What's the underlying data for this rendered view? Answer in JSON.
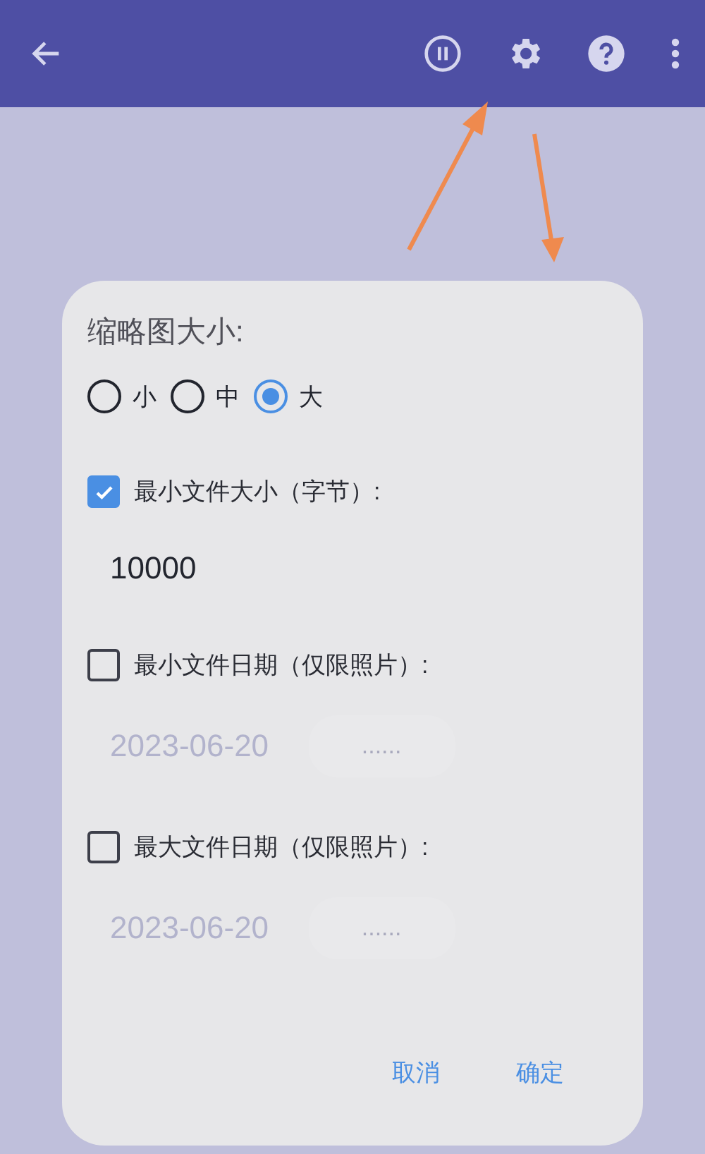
{
  "app_bar": {
    "buttons": [
      {
        "kind": "back"
      },
      {
        "kind": "pause"
      },
      {
        "kind": "settings"
      },
      {
        "kind": "help"
      },
      {
        "kind": "more"
      }
    ]
  },
  "dialog": {
    "title": "缩略图大小:",
    "size_options": [
      {
        "label": "小",
        "selected": false
      },
      {
        "label": "中",
        "selected": false
      },
      {
        "label": "大",
        "selected": true
      }
    ],
    "filters": [
      {
        "kind": "number",
        "label": "最小文件大小（字节）:",
        "checked": true,
        "value": "10000"
      },
      {
        "kind": "date",
        "label": "最小文件日期（仅限照片）:",
        "checked": false,
        "value": "2023-06-20",
        "button": "......"
      },
      {
        "kind": "date",
        "label": "最大文件日期（仅限照片）:",
        "checked": false,
        "value": "2023-06-20",
        "button": "......"
      }
    ],
    "buttons": [
      "取消",
      "确定"
    ]
  }
}
